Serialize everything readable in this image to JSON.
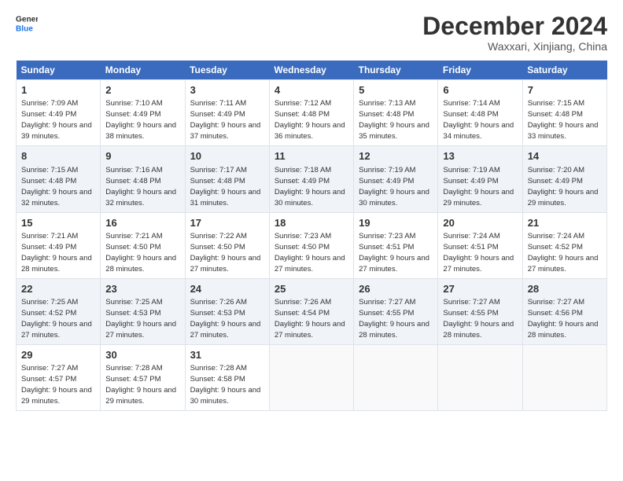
{
  "logo": {
    "line1": "General",
    "line2": "Blue"
  },
  "title": "December 2024",
  "subtitle": "Waxxari, Xinjiang, China",
  "days_header": [
    "Sunday",
    "Monday",
    "Tuesday",
    "Wednesday",
    "Thursday",
    "Friday",
    "Saturday"
  ],
  "weeks": [
    [
      {
        "day": "1",
        "rise": "7:09 AM",
        "set": "4:49 PM",
        "daylight": "9 hours and 39 minutes."
      },
      {
        "day": "2",
        "rise": "7:10 AM",
        "set": "4:49 PM",
        "daylight": "9 hours and 38 minutes."
      },
      {
        "day": "3",
        "rise": "7:11 AM",
        "set": "4:49 PM",
        "daylight": "9 hours and 37 minutes."
      },
      {
        "day": "4",
        "rise": "7:12 AM",
        "set": "4:48 PM",
        "daylight": "9 hours and 36 minutes."
      },
      {
        "day": "5",
        "rise": "7:13 AM",
        "set": "4:48 PM",
        "daylight": "9 hours and 35 minutes."
      },
      {
        "day": "6",
        "rise": "7:14 AM",
        "set": "4:48 PM",
        "daylight": "9 hours and 34 minutes."
      },
      {
        "day": "7",
        "rise": "7:15 AM",
        "set": "4:48 PM",
        "daylight": "9 hours and 33 minutes."
      }
    ],
    [
      {
        "day": "8",
        "rise": "7:15 AM",
        "set": "4:48 PM",
        "daylight": "9 hours and 32 minutes."
      },
      {
        "day": "9",
        "rise": "7:16 AM",
        "set": "4:48 PM",
        "daylight": "9 hours and 32 minutes."
      },
      {
        "day": "10",
        "rise": "7:17 AM",
        "set": "4:48 PM",
        "daylight": "9 hours and 31 minutes."
      },
      {
        "day": "11",
        "rise": "7:18 AM",
        "set": "4:49 PM",
        "daylight": "9 hours and 30 minutes."
      },
      {
        "day": "12",
        "rise": "7:19 AM",
        "set": "4:49 PM",
        "daylight": "9 hours and 30 minutes."
      },
      {
        "day": "13",
        "rise": "7:19 AM",
        "set": "4:49 PM",
        "daylight": "9 hours and 29 minutes."
      },
      {
        "day": "14",
        "rise": "7:20 AM",
        "set": "4:49 PM",
        "daylight": "9 hours and 29 minutes."
      }
    ],
    [
      {
        "day": "15",
        "rise": "7:21 AM",
        "set": "4:49 PM",
        "daylight": "9 hours and 28 minutes."
      },
      {
        "day": "16",
        "rise": "7:21 AM",
        "set": "4:50 PM",
        "daylight": "9 hours and 28 minutes."
      },
      {
        "day": "17",
        "rise": "7:22 AM",
        "set": "4:50 PM",
        "daylight": "9 hours and 27 minutes."
      },
      {
        "day": "18",
        "rise": "7:23 AM",
        "set": "4:50 PM",
        "daylight": "9 hours and 27 minutes."
      },
      {
        "day": "19",
        "rise": "7:23 AM",
        "set": "4:51 PM",
        "daylight": "9 hours and 27 minutes."
      },
      {
        "day": "20",
        "rise": "7:24 AM",
        "set": "4:51 PM",
        "daylight": "9 hours and 27 minutes."
      },
      {
        "day": "21",
        "rise": "7:24 AM",
        "set": "4:52 PM",
        "daylight": "9 hours and 27 minutes."
      }
    ],
    [
      {
        "day": "22",
        "rise": "7:25 AM",
        "set": "4:52 PM",
        "daylight": "9 hours and 27 minutes."
      },
      {
        "day": "23",
        "rise": "7:25 AM",
        "set": "4:53 PM",
        "daylight": "9 hours and 27 minutes."
      },
      {
        "day": "24",
        "rise": "7:26 AM",
        "set": "4:53 PM",
        "daylight": "9 hours and 27 minutes."
      },
      {
        "day": "25",
        "rise": "7:26 AM",
        "set": "4:54 PM",
        "daylight": "9 hours and 27 minutes."
      },
      {
        "day": "26",
        "rise": "7:27 AM",
        "set": "4:55 PM",
        "daylight": "9 hours and 28 minutes."
      },
      {
        "day": "27",
        "rise": "7:27 AM",
        "set": "4:55 PM",
        "daylight": "9 hours and 28 minutes."
      },
      {
        "day": "28",
        "rise": "7:27 AM",
        "set": "4:56 PM",
        "daylight": "9 hours and 28 minutes."
      }
    ],
    [
      {
        "day": "29",
        "rise": "7:27 AM",
        "set": "4:57 PM",
        "daylight": "9 hours and 29 minutes."
      },
      {
        "day": "30",
        "rise": "7:28 AM",
        "set": "4:57 PM",
        "daylight": "9 hours and 29 minutes."
      },
      {
        "day": "31",
        "rise": "7:28 AM",
        "set": "4:58 PM",
        "daylight": "9 hours and 30 minutes."
      },
      null,
      null,
      null,
      null
    ]
  ]
}
